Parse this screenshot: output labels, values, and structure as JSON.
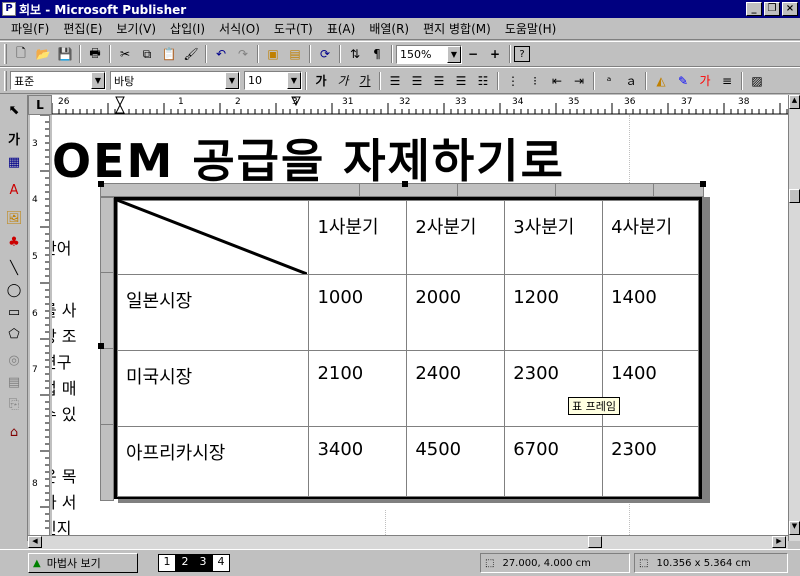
{
  "window": {
    "title": "회보 - Microsoft Publisher",
    "app_icon": "publisher-icon"
  },
  "menu": [
    "파일(F)",
    "편집(E)",
    "보기(V)",
    "삽입(I)",
    "서식(O)",
    "도구(T)",
    "표(A)",
    "배열(R)",
    "편지 병합(M)",
    "도움말(H)"
  ],
  "standard_toolbar": {
    "zoom": "150%"
  },
  "format_toolbar": {
    "style": "표준",
    "font": "바탕",
    "size": "10"
  },
  "ruler": {
    "corner": "L",
    "h_ticks": [
      "26",
      "1",
      "2",
      "3",
      "31",
      "32",
      "33",
      "34",
      "35",
      "36",
      "37",
      "38"
    ],
    "v_ticks": [
      "3",
      "4",
      "5",
      "6",
      "7",
      "8"
    ]
  },
  "document": {
    "headline": "OEM 공급을 자제하기로",
    "side_text": [
      "안어",
      "를 사",
      "장 조",
      "연구",
      "업 매",
      "수 있",
      "은 목",
      "가 서",
      "인지"
    ],
    "table": {
      "header": [
        "",
        "1사분기",
        "2사분기",
        "3사분기",
        "4사분기"
      ],
      "rows": [
        [
          "일본시장",
          "1000",
          "2000",
          "1200",
          "1400"
        ],
        [
          "미국시장",
          "2100",
          "2400",
          "2300",
          "1400"
        ],
        [
          "아프리카시장",
          "3400",
          "4500",
          "6700",
          "2300"
        ]
      ]
    },
    "tooltip": "표 프레임"
  },
  "status": {
    "wizard": "마법사 보기",
    "pages": [
      "1",
      "2",
      "3",
      "4"
    ],
    "position": "27.000, 4.000 cm",
    "size": "10.356 x  5.364 cm"
  }
}
